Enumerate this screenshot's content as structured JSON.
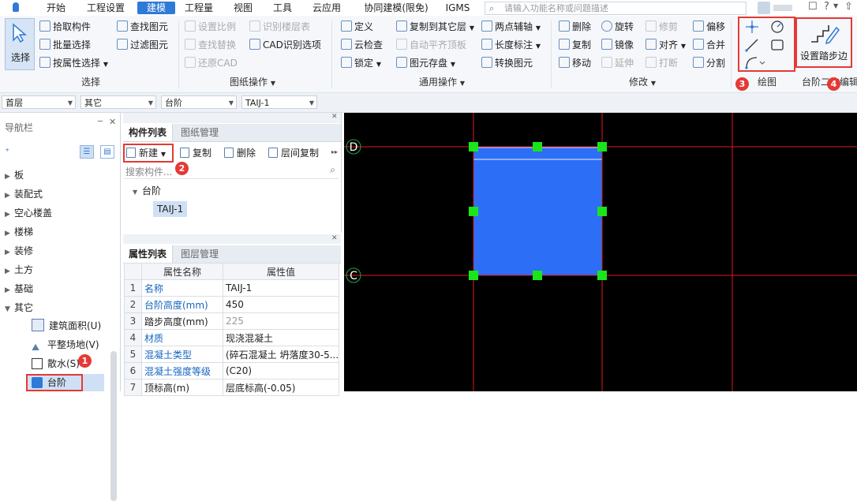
{
  "menu": {
    "items": [
      "开始",
      "工程设置",
      "建模",
      "工程量",
      "视图",
      "工具",
      "云应用",
      "协同建模(限免)",
      "IGMS"
    ],
    "active": "建模",
    "search_placeholder": "请输入功能名称或问题描述"
  },
  "ribbon": {
    "select": {
      "big_label": "选择",
      "items": [
        "拾取构件",
        "批量选择",
        "按属性选择",
        "查找图元",
        "过滤图元"
      ],
      "group": "选择"
    },
    "drawing_ops": {
      "items": [
        "设置比例",
        "识别楼层表",
        "查找替换",
        "CAD识别选项",
        "还原CAD"
      ],
      "group": "图纸操作"
    },
    "common_ops": {
      "items": [
        "定义",
        "复制到其它层",
        "两点辅轴",
        "云检查",
        "自动平齐顶板",
        "长度标注",
        "锁定",
        "图元存盘",
        "转换图元"
      ],
      "group": "通用操作"
    },
    "modify": {
      "items": [
        "删除",
        "旋转",
        "修剪",
        "偏移",
        "复制",
        "镜像",
        "对齐",
        "合并",
        "移动",
        "延伸",
        "打断",
        "分割"
      ],
      "group": "修改"
    },
    "draw": {
      "group": "绘图",
      "icons": [
        "point-icon",
        "rotate-point-icon",
        "line-icon",
        "rectangle-icon",
        "arc-icon"
      ]
    },
    "step": {
      "big_label": "设置踏步边",
      "group": "台阶二次编辑"
    }
  },
  "dropdowns": [
    "首层",
    "其它",
    "台阶",
    "TAIJ-1"
  ],
  "nav": {
    "title": "导航栏",
    "tree": [
      "板",
      "装配式",
      "空心楼盖",
      "楼梯",
      "装修",
      "土方",
      "基础",
      "其它"
    ],
    "children": [
      "建筑面积(U)",
      "平整场地(V)",
      "散水(S)",
      "台阶"
    ]
  },
  "component_panel": {
    "tabs": [
      "构件列表",
      "图纸管理"
    ],
    "toolbar": [
      "新建",
      "复制",
      "删除",
      "层间复制"
    ],
    "search_placeholder": "搜索构件...",
    "tree_root": "台阶",
    "tree_item": "TAIJ-1"
  },
  "property_panel": {
    "tabs": [
      "属性列表",
      "图层管理"
    ],
    "headers": [
      "属性名称",
      "属性值"
    ],
    "rows": [
      {
        "no": "1",
        "name": "名称",
        "value": "TAIJ-1",
        "link": true,
        "dim": false
      },
      {
        "no": "2",
        "name": "台阶高度(mm)",
        "value": "450",
        "link": true,
        "dim": false
      },
      {
        "no": "3",
        "name": "踏步高度(mm)",
        "value": "225",
        "link": false,
        "dim": true
      },
      {
        "no": "4",
        "name": "材质",
        "value": "现浇混凝土",
        "link": true,
        "dim": false
      },
      {
        "no": "5",
        "name": "混凝土类型",
        "value": "(碎石混凝土 坍落度30-5...",
        "link": true,
        "dim": false
      },
      {
        "no": "6",
        "name": "混凝土强度等级",
        "value": "(C20)",
        "link": true,
        "dim": false
      },
      {
        "no": "7",
        "name": "顶标高(m)",
        "value": "层底标高(-0.05)",
        "link": false,
        "dim": false
      }
    ]
  },
  "badges": [
    "1",
    "2",
    "3",
    "4"
  ],
  "canvas": {
    "axis_labels": [
      "D",
      "C"
    ],
    "colors": {
      "background": "#000000",
      "grid": "#e0181e",
      "slab": "#2d6ef6",
      "grip": "#19e619"
    }
  }
}
